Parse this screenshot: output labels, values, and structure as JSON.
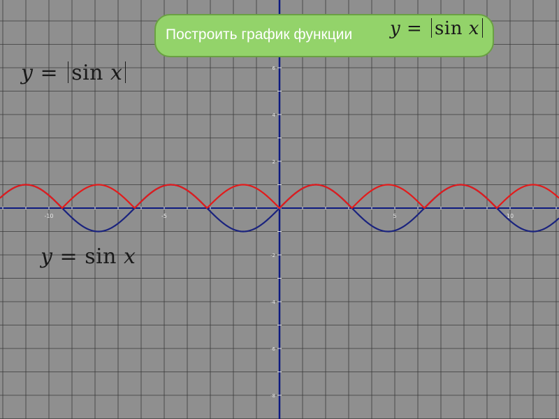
{
  "title": {
    "text": "Построить график функции",
    "formula": {
      "lhs": "y",
      "eq": "=",
      "fn": "sin",
      "arg": "x",
      "abs": true
    }
  },
  "labels": {
    "abs_sin": {
      "lhs": "y",
      "eq": "=",
      "fn": "sin",
      "arg": "x",
      "abs": true
    },
    "sin": {
      "lhs": "y",
      "eq": "=",
      "fn": "sin",
      "arg": "x",
      "abs": false
    }
  },
  "chart_data": {
    "type": "line",
    "x_range": [
      -12,
      12
    ],
    "y_range": [
      -8,
      8
    ],
    "x_tick_labels": [
      {
        "value": -10,
        "label": "-10"
      },
      {
        "value": -5,
        "label": "-5"
      },
      {
        "value": 5,
        "label": "5"
      },
      {
        "value": 10,
        "label": "10"
      }
    ],
    "y_tick_labels": [
      {
        "value": 6,
        "label": "6"
      },
      {
        "value": 4,
        "label": "4"
      },
      {
        "value": 2,
        "label": "2"
      },
      {
        "value": -2,
        "label": "-2"
      },
      {
        "value": -4,
        "label": "-4"
      },
      {
        "value": -6,
        "label": "-6"
      },
      {
        "value": -8,
        "label": "-8"
      }
    ],
    "grid": true,
    "series": [
      {
        "function": "sin(x)",
        "color": "#1a237e"
      },
      {
        "function": "|sin(x)|",
        "color": "#e31b1b"
      }
    ],
    "colors": {
      "background": "#8f8f8f",
      "grid": "#3a3a3a",
      "axis": "#0d1a80"
    }
  }
}
